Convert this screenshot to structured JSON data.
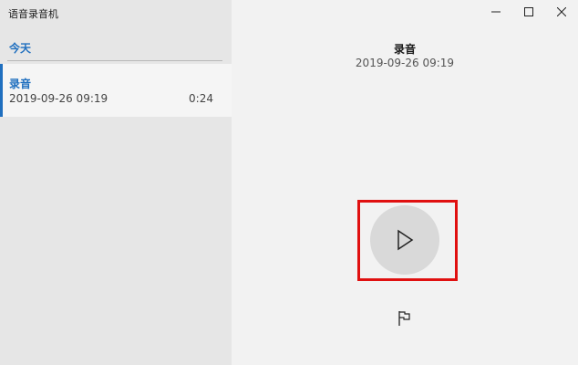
{
  "app": {
    "title": "语音录音机"
  },
  "sidebar": {
    "group_header": "今天",
    "recordings": [
      {
        "name": "录音",
        "date": "2019-09-26 09:19",
        "duration": "0:24"
      }
    ]
  },
  "main": {
    "title": "录音",
    "date": "2019-09-26 09:19"
  },
  "colors": {
    "accent": "#1f6fbf",
    "highlight": "#e01010",
    "sidebar_bg": "#e6e6e6",
    "main_bg": "#f2f2f2",
    "play_circle": "#d9d9d9"
  },
  "icons": {
    "minimize": "minimize-icon",
    "maximize": "maximize-icon",
    "close": "close-icon",
    "play": "play-icon",
    "flag": "flag-icon"
  }
}
